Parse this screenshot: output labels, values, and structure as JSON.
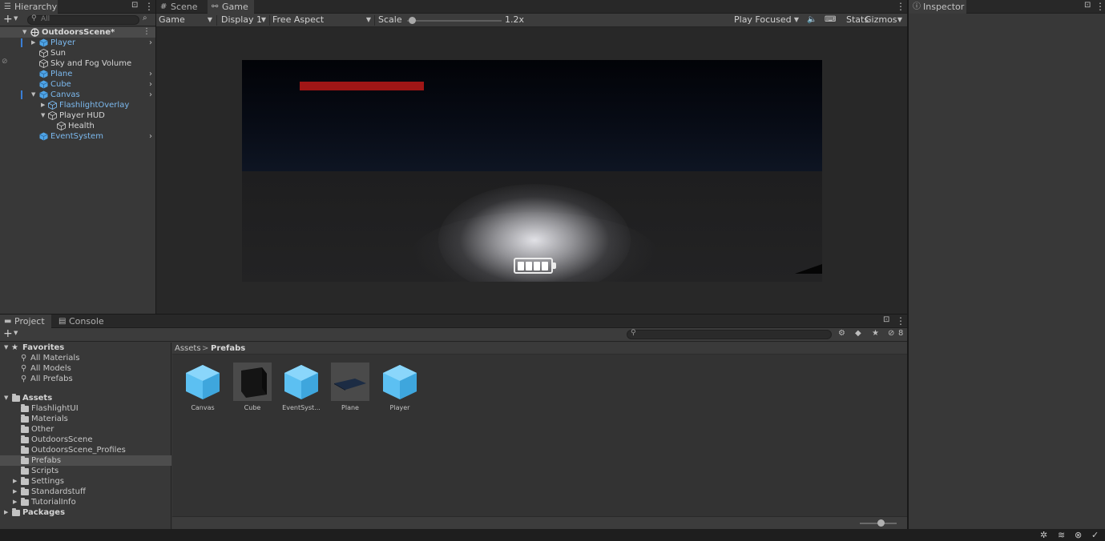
{
  "hierarchy": {
    "tab_label": "Hierarchy",
    "search_placeholder": "All",
    "scene_name": "OutdoorsScene*",
    "items": [
      {
        "label": "Player"
      },
      {
        "label": "Sun"
      },
      {
        "label": "Sky and Fog Volume"
      },
      {
        "label": "Plane"
      },
      {
        "label": "Cube"
      },
      {
        "label": "Canvas"
      },
      {
        "label": "FlashlightOverlay"
      },
      {
        "label": "Player HUD"
      },
      {
        "label": "Health"
      },
      {
        "label": "EventSystem"
      }
    ]
  },
  "game": {
    "tabs": [
      {
        "label": "Scene",
        "icon": "grid-icon"
      },
      {
        "label": "Game",
        "icon": "gamepad-icon"
      }
    ],
    "toolbar": {
      "view_mode": "Game",
      "display": "Display 1",
      "aspect": "Free Aspect",
      "scale_label": "Scale",
      "scale_value": "1.2x",
      "scale_level": 0.02,
      "play_mode": "Play Focused",
      "stats": "Stats",
      "gizmos": "Gizmos"
    },
    "hud": {
      "health_color": "#a01616",
      "battery_cells": 4
    }
  },
  "inspector": {
    "tab_label": "Inspector"
  },
  "project": {
    "tabs": [
      {
        "label": "Project"
      },
      {
        "label": "Console"
      }
    ],
    "hidden_count": "8",
    "favorites": {
      "label": "Favorites",
      "items": [
        "All Materials",
        "All Models",
        "All Prefabs"
      ]
    },
    "assets": {
      "label": "Assets",
      "folders": [
        "FlashlightUI",
        "Materials",
        "Other",
        "OutdoorsScene",
        "OutdoorsScene_Profiles",
        "Prefabs",
        "Scripts",
        "Settings",
        "Standardstuff",
        "TutorialInfo"
      ]
    },
    "packages_label": "Packages",
    "breadcrumb": {
      "root": "Assets",
      "separator": ">",
      "current": "Prefabs"
    },
    "prefabs": [
      {
        "label": "Canvas",
        "icon": "prefab-cube-icon"
      },
      {
        "label": "Cube",
        "icon": "dark-cube-thumbnail"
      },
      {
        "label": "EventSyst...",
        "icon": "prefab-cube-icon"
      },
      {
        "label": "Plane",
        "icon": "plane-thumbnail"
      },
      {
        "label": "Player",
        "icon": "prefab-cube-icon"
      }
    ]
  }
}
